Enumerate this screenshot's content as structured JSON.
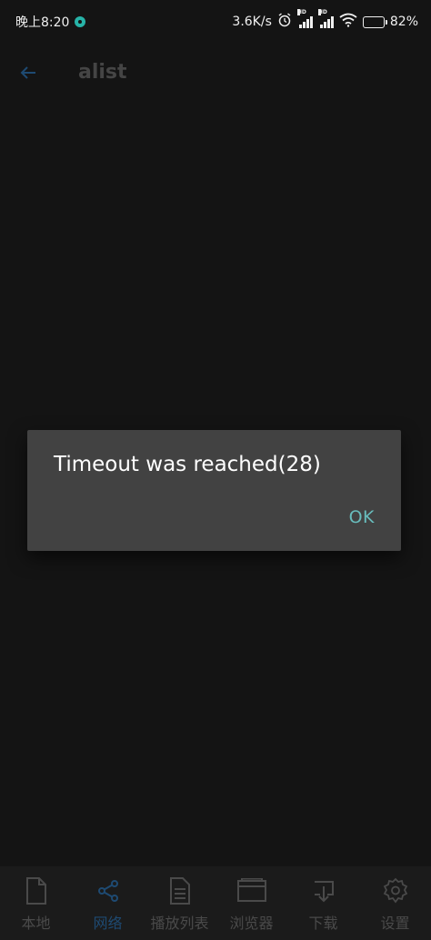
{
  "status_bar": {
    "time": "晚上8:20",
    "network_speed": "3.6K/s",
    "signal_1_tag": "HD",
    "signal_2_tag": "HD",
    "battery_percent": "82%",
    "battery_level": 0.82
  },
  "app_bar": {
    "title": "alist",
    "back_icon": "back-arrow-icon"
  },
  "dialog": {
    "message": "Timeout was reached(28)",
    "ok_label": "OK"
  },
  "bottom_nav": {
    "items": [
      {
        "label": "本地",
        "icon": "file-icon",
        "active": false
      },
      {
        "label": "网络",
        "icon": "share-icon",
        "active": true
      },
      {
        "label": "播放列表",
        "icon": "list-icon",
        "active": false
      },
      {
        "label": "浏览器",
        "icon": "browser-icon",
        "active": false
      },
      {
        "label": "下载",
        "icon": "download-icon",
        "active": false
      },
      {
        "label": "设置",
        "icon": "gear-icon",
        "active": false
      }
    ]
  },
  "colors": {
    "background": "#141414",
    "dialog_bg": "#424242",
    "accent_ok": "#68bcbc",
    "active_nav": "#1e4a72",
    "inactive_nav": "#4a4a4a"
  }
}
